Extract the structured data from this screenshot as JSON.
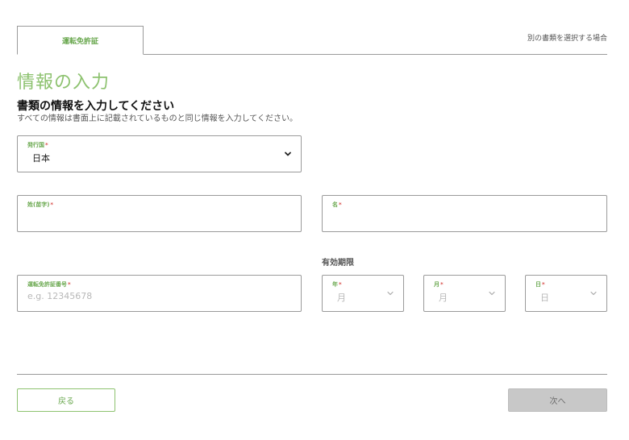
{
  "tabs": {
    "active_label": "運転免許証",
    "alt_link": "別の書類を選択する場合"
  },
  "page_title": "情報の入力",
  "section": {
    "title": "書類の情報を入力してください",
    "description": "すべての情報は書面上に記載されているものと同じ情報を入力してください。"
  },
  "required_mark": "*",
  "fields": {
    "country": {
      "label": "発行国",
      "value": "日本"
    },
    "last_name": {
      "label": "姓(苗字)",
      "value": ""
    },
    "first_name": {
      "label": "名",
      "value": ""
    },
    "license_number": {
      "label": "運転免許証番号",
      "placeholder": "e.g. 12345678"
    },
    "validity_heading": "有効期限",
    "year": {
      "label": "年",
      "placeholder": "月"
    },
    "month": {
      "label": "月",
      "placeholder": "月"
    },
    "day": {
      "label": "日",
      "placeholder": "日"
    }
  },
  "buttons": {
    "back": "戻る",
    "next": "次へ"
  },
  "colors": {
    "accent": "#8dc26f",
    "label_green": "#6aa84f",
    "required": "#d9534f",
    "disabled_button": "#c8c8c8"
  }
}
